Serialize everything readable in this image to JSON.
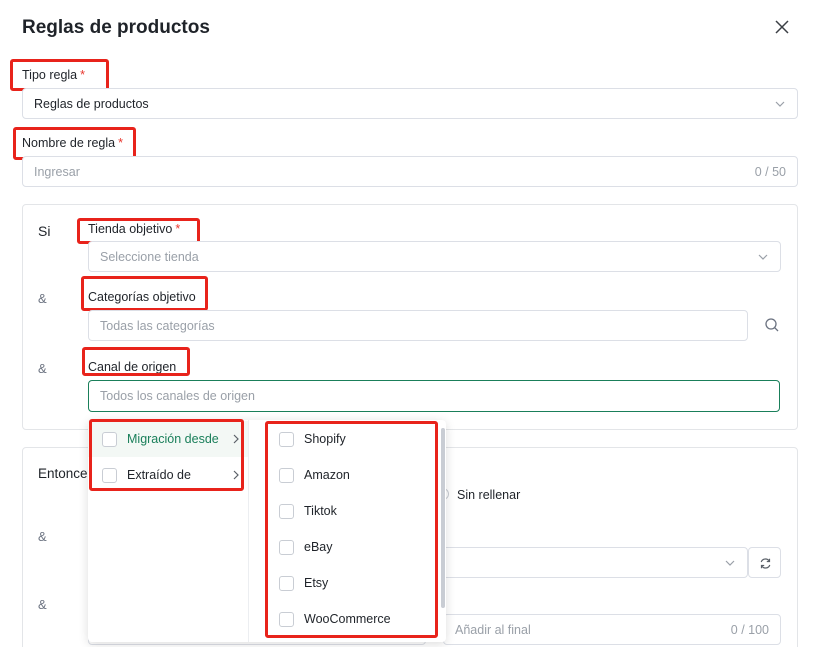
{
  "dialog": {
    "title": "Reglas de productos"
  },
  "rule_type": {
    "label": "Tipo regla",
    "required_mark": "*",
    "value": "Reglas de productos"
  },
  "rule_name": {
    "label": "Nombre de regla",
    "required_mark": "*",
    "placeholder": "Ingresar",
    "counter": "0 / 50"
  },
  "if_section": {
    "label": "Si",
    "target_store": {
      "label": "Tienda objetivo",
      "required_mark": "*",
      "placeholder": "Seleccione tienda"
    },
    "amp1": "&",
    "target_categories": {
      "label": "Categorías objetivo",
      "placeholder": "Todas las categorías"
    },
    "amp2": "&",
    "source_channel": {
      "label": "Canal de origen",
      "placeholder": "Todos los canales de origen"
    }
  },
  "then_section": {
    "label": "Entonces",
    "radio_label": "Sin rellenar",
    "amp1": "&",
    "amp2": "&",
    "append_input": {
      "placeholder": "Añadir al final",
      "counter": "0 / 100"
    }
  },
  "dropdown": {
    "groups": [
      {
        "label": "Migración desde",
        "active": true
      },
      {
        "label": "Extraído de",
        "active": false
      }
    ],
    "options": [
      "Shopify",
      "Amazon",
      "Tiktok",
      "eBay",
      "Etsy",
      "WooCommerce"
    ]
  },
  "colors": {
    "accent": "#1a7f5a",
    "highlight": "#e8231b",
    "required": "#e8372e"
  }
}
